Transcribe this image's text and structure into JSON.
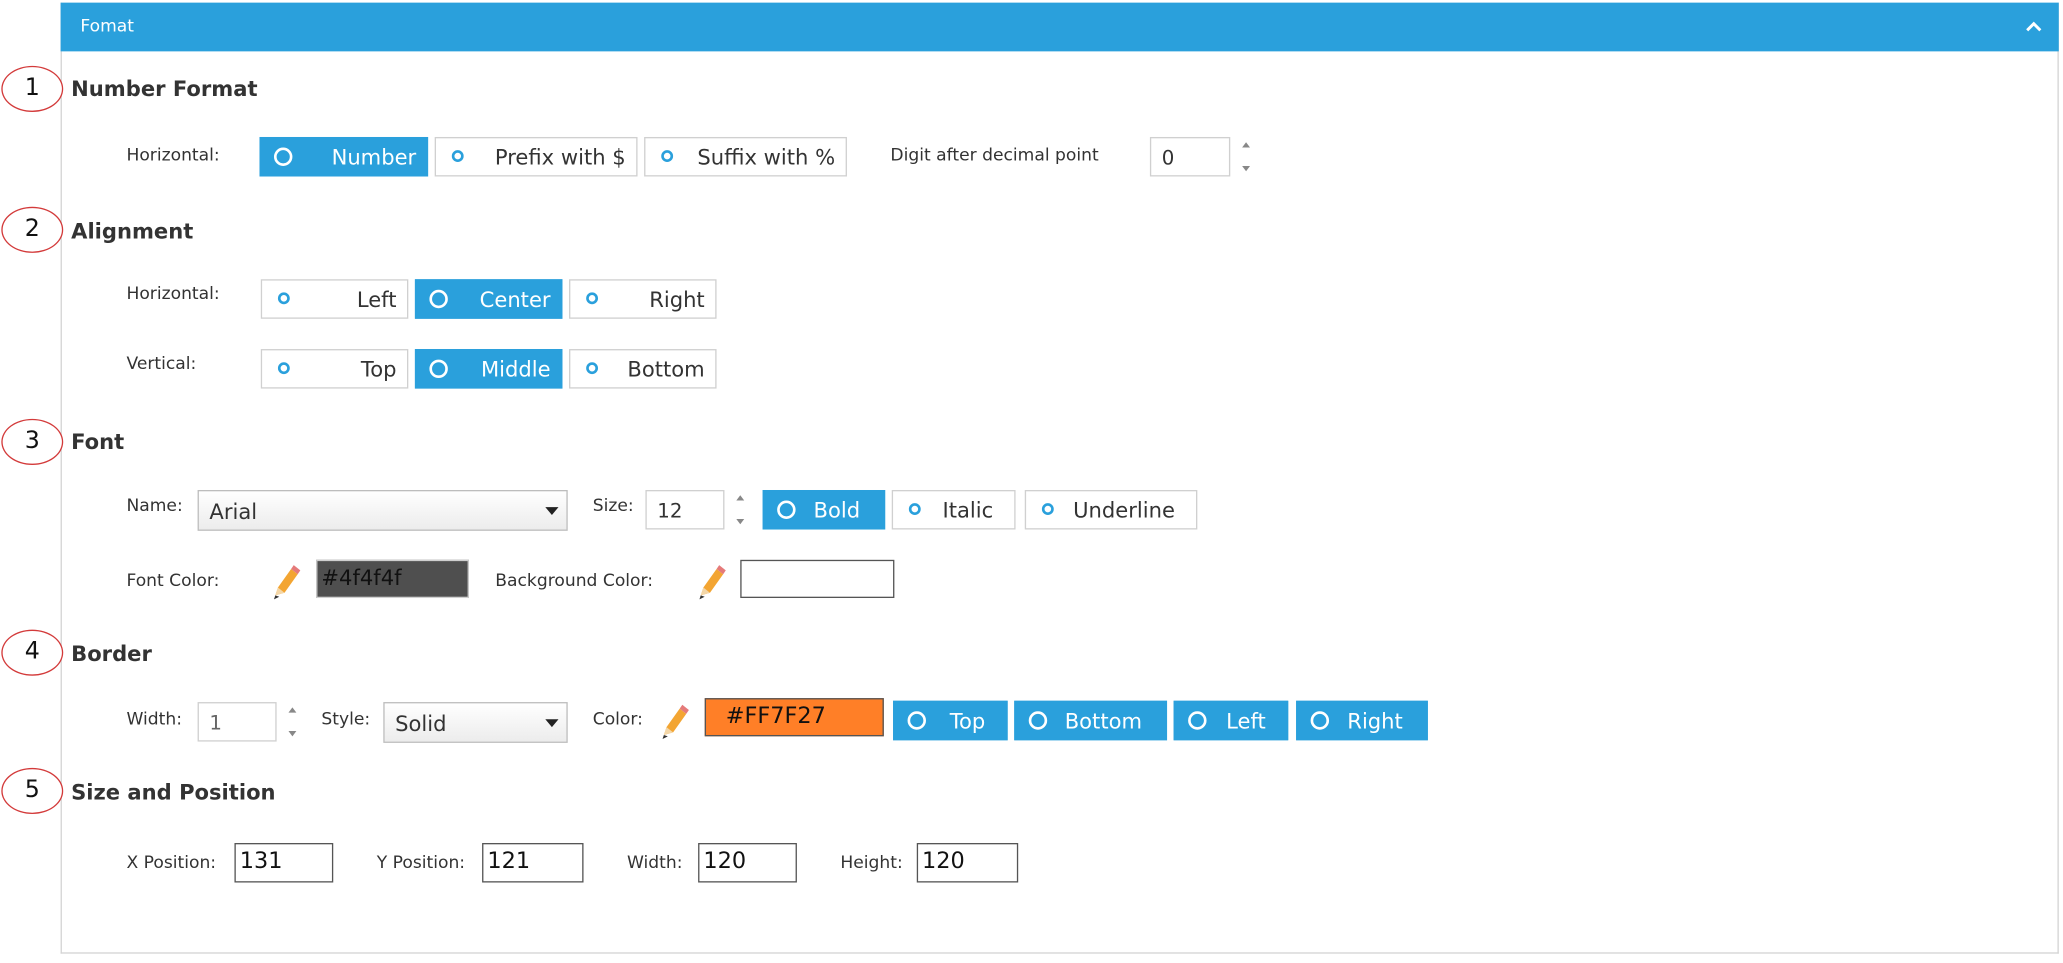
{
  "panel": {
    "title": "Fomat"
  },
  "steps": [
    "1",
    "2",
    "3",
    "4",
    "5"
  ],
  "number_format": {
    "title": "Number Format",
    "horizontal_label": "Horizontal:",
    "options": [
      "Number",
      "Prefix with $",
      "Suffix with %"
    ],
    "selected": "Number",
    "digits_label": "Digit after decimal point",
    "digits_value": "0"
  },
  "alignment": {
    "title": "Alignment",
    "horizontal_label": "Horizontal:",
    "horizontal_options": [
      "Left",
      "Center",
      "Right"
    ],
    "horizontal_selected": "Center",
    "vertical_label": "Vertical:",
    "vertical_options": [
      "Top",
      "Middle",
      "Bottom"
    ],
    "vertical_selected": "Middle"
  },
  "font": {
    "title": "Font",
    "name_label": "Name:",
    "name_value": "Arial",
    "size_label": "Size:",
    "size_value": "12",
    "styles": [
      "Bold",
      "Italic",
      "Underline"
    ],
    "selected_styles": [
      "Bold"
    ],
    "font_color_label": "Font Color:",
    "font_color_value": "#4f4f4f",
    "font_color_text": "#4f4f4f",
    "bg_color_label": "Background Color:",
    "bg_color_value": "#ffffff"
  },
  "border": {
    "title": "Border",
    "width_label": "Width:",
    "width_value": "1",
    "style_label": "Style:",
    "style_value": "Solid",
    "color_label": "Color:",
    "color_value": "#FF7F27",
    "color_text": "#FF7F27",
    "sides": [
      "Top",
      "Bottom",
      "Left",
      "Right"
    ],
    "selected_sides": [
      "Top",
      "Bottom",
      "Left",
      "Right"
    ]
  },
  "size_position": {
    "title": "Size and Position",
    "x_label": "X Position:",
    "x_value": "131",
    "y_label": "Y Position:",
    "y_value": "121",
    "width_label": "Width:",
    "width_value": "120",
    "height_label": "Height:",
    "height_value": "120"
  },
  "colors": {
    "accent": "#2aa0dc",
    "step_circle": "#d33a3a"
  },
  "icons": {
    "collapse": "chevron-up-icon",
    "color_picker": "pencil-icon",
    "spinner": "spinner-arrows-icon"
  }
}
